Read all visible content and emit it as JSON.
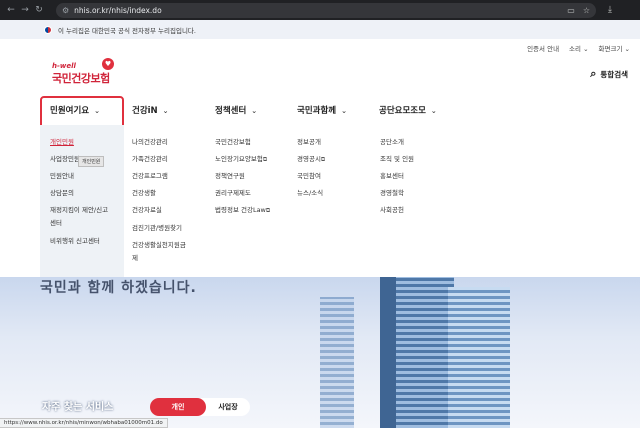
{
  "browser": {
    "url": "nhis.or.kr/nhis/index.do",
    "status_url": "https://www.nhis.or.kr/nhis/minwon/wbhaba01000m01.do"
  },
  "gov_banner": {
    "text": "이 누리집은 대한민국 공식 전자정부 누리집입니다."
  },
  "util": {
    "cert": "인증서 안내",
    "sound": "소리",
    "zoom": "화면크기"
  },
  "logo": {
    "hwell": "h-well",
    "name": "국민건강보험"
  },
  "search": {
    "label": "통합검색"
  },
  "gnb": [
    {
      "label": "민원여기요"
    },
    {
      "label": "건강iN"
    },
    {
      "label": "정책센터"
    },
    {
      "label": "국민과함께"
    },
    {
      "label": "공단요모조모"
    }
  ],
  "mega": {
    "col0": [
      "개인민원",
      "사업장민원",
      "민원안내",
      "상담문의",
      "재정지킴이 제안/신고",
      "센터",
      "비위행위 신고센터"
    ],
    "col1": [
      "나의건강관리",
      "가족건강관리",
      "건강프로그램",
      "건강생활",
      "건강자료실",
      "검진기관/병원찾기",
      "건강생활실천지원금",
      "제"
    ],
    "col2": [
      "국민건강보험",
      "노인장기요양보험",
      "정책연구원",
      "권리구제제도",
      "법령정보 건강Law"
    ],
    "col3": [
      "정보공개",
      "경영공시",
      "국민참여",
      "뉴스/소식"
    ],
    "col4": [
      "공단소개",
      "조직 및 인원",
      "홍보센터",
      "경영철학",
      "사회공헌"
    ]
  },
  "tooltip": "개인민원",
  "hero": {
    "headline": "국민과 함께 하겠습니다."
  },
  "freq_service": {
    "title": "자주 찾는 서비스",
    "tab_on": "개인",
    "tab_off": "사업장"
  }
}
